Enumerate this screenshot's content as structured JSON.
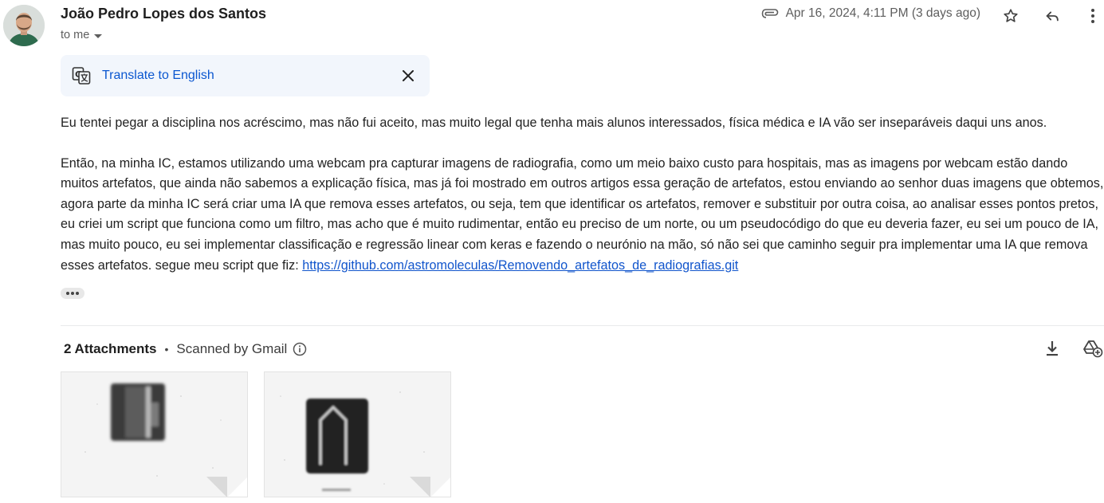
{
  "sender": {
    "name": "João Pedro Lopes dos Santos",
    "recipient_label": "to me"
  },
  "meta": {
    "date": "Apr 16, 2024, 4:11 PM (3 days ago)",
    "icons": [
      "attachment-icon",
      "star-icon",
      "reply-icon",
      "more-vert-icon"
    ]
  },
  "translate": {
    "link_label": "Translate to English",
    "icons": [
      "translate-icon",
      "close-icon"
    ]
  },
  "body": {
    "paragraph1": "Eu tentei pegar a disciplina nos acréscimo, mas não fui aceito, mas muito legal que tenha mais alunos interessados, física médica e IA vão ser inseparáveis daqui uns anos.",
    "paragraph2": "Então, na minha IC, estamos utilizando uma webcam pra capturar imagens de radiografia, como um meio baixo custo para hospitais, mas as imagens por webcam estão dando muitos artefatos, que ainda não sabemos a explicação física, mas já foi mostrado em outros artigos essa geração de artefatos, estou enviando ao senhor duas imagens que obtemos, agora parte da minha IC será criar uma IA que remova esses artefatos, ou seja, tem que identificar os artefatos, remover e substituir por outra coisa, ao analisar esses pontos pretos, eu criei um script que funciona como um filtro, mas acho que é muito rudimentar, então eu preciso de um norte, ou um pseudocódigo do que eu deveria fazer, eu sei um pouco de IA, mas muito pouco, eu sei implementar classificação e regressão linear com keras e fazendo o neurónio na mão, só não sei que caminho seguir pra implementar uma IA que remova esses artefatos. segue meu script que fiz: ",
    "link": "https://github.com/astromoleculas/Removendo_artefatos_de_radiografias.git"
  },
  "attachments": {
    "count_label": "2 Attachments",
    "separator": "•",
    "scanned_label": "Scanned by Gmail",
    "icons": [
      "info-icon",
      "download-all-icon",
      "add-to-drive-icon"
    ],
    "items": [
      {
        "kind": "image",
        "subject": "radiograph-rectangular-object"
      },
      {
        "kind": "image",
        "subject": "radiograph-arch-object"
      }
    ]
  },
  "colors": {
    "link": "#0b57d0",
    "translate_bg": "#f2f6fc",
    "text": "#222222",
    "muted": "#5e5e5e"
  }
}
